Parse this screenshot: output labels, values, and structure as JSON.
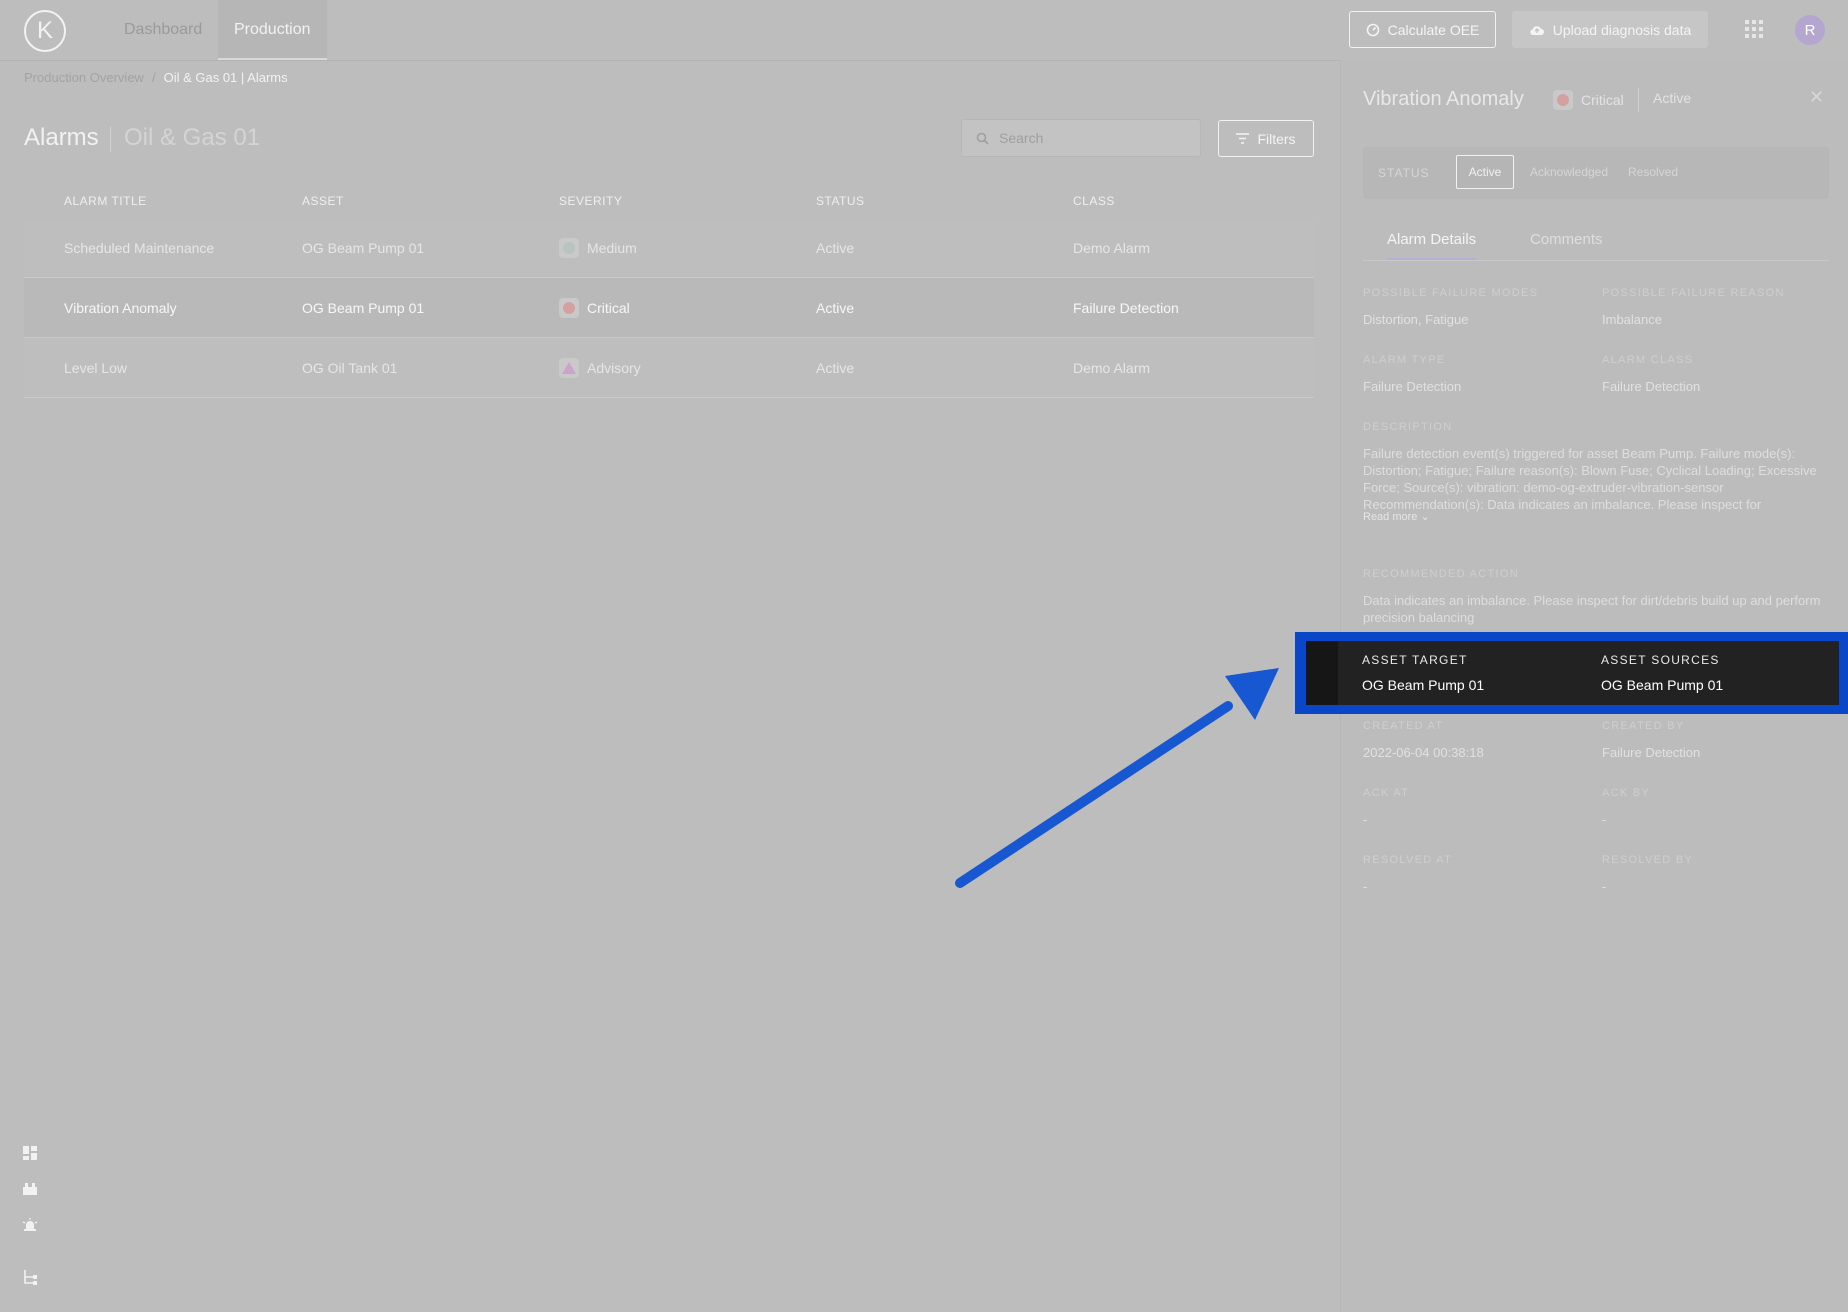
{
  "topbar": {
    "logo_text": "K",
    "tabs": [
      {
        "label": "Dashboard"
      },
      {
        "label": "Production"
      }
    ],
    "calc_oee_label": "Calculate OEE",
    "upload_label": "Upload diagnosis data",
    "avatar_initial": "R"
  },
  "breadcrumb": {
    "root": "Production Overview",
    "separator": "/",
    "current": "Oil & Gas 01 | Alarms"
  },
  "page": {
    "title": "Alarms",
    "subtitle": "Oil & Gas 01",
    "search_placeholder": "Search",
    "filters_label": "Filters"
  },
  "table": {
    "headers": [
      "ALARM TITLE",
      "ASSET",
      "SEVERITY",
      "STATUS",
      "CLASS"
    ],
    "rows": [
      {
        "title": "Scheduled Maintenance",
        "asset": "OG Beam Pump 01",
        "severity": "Medium",
        "status": "Active",
        "class": "Demo Alarm"
      },
      {
        "title": "Vibration Anomaly",
        "asset": "OG Beam Pump 01",
        "severity": "Critical",
        "status": "Active",
        "class": "Failure Detection"
      },
      {
        "title": "Level Low",
        "asset": "OG Oil Tank 01",
        "severity": "Advisory",
        "status": "Active",
        "class": "Demo Alarm"
      }
    ]
  },
  "panel": {
    "title": "Vibration Anomaly",
    "severity": "Critical",
    "status": "Active",
    "status_label": "STATUS",
    "status_options": [
      "Active",
      "Acknowledged",
      "Resolved"
    ],
    "tabs": [
      "Alarm Details",
      "Comments"
    ],
    "fields": {
      "failure_modes_label": "POSSIBLE FAILURE MODES",
      "failure_modes": "Distortion, Fatigue",
      "failure_reason_label": "POSSIBLE FAILURE REASON",
      "failure_reason": "Imbalance",
      "alarm_type_label": "ALARM TYPE",
      "alarm_type": "Failure Detection",
      "alarm_class_label": "ALARM CLASS",
      "alarm_class": "Failure Detection",
      "description_label": "DESCRIPTION",
      "description": "Failure detection event(s) triggered for asset Beam Pump. Failure mode(s): Distortion; Fatigue; Failure reason(s): Blown Fuse; Cyclical Loading; Excessive Force; Source(s): vibration: demo-og-extruder-vibration-sensor Recommendation(s): Data indicates an imbalance. Please inspect for",
      "read_more": "Read more",
      "recommended_label": "RECOMMENDED ACTION",
      "recommended": "Data indicates an imbalance. Please inspect for dirt/debris build up and perform precision balancing",
      "asset_target_label": "ASSET TARGET",
      "asset_target": "OG Beam Pump 01",
      "asset_sources_label": "ASSET SOURCES",
      "asset_sources": "OG Beam Pump 01",
      "created_at_label": "CREATED AT",
      "created_at": "2022-06-04 00:38:18",
      "created_by_label": "CREATED BY",
      "created_by": "Failure Detection",
      "ack_at_label": "ACK AT",
      "ack_at": "-",
      "ack_by_label": "ACK BY",
      "ack_by": "-",
      "resolved_at_label": "RESOLVED AT",
      "resolved_at": "-",
      "resolved_by_label": "RESOLVED BY",
      "resolved_by": "-"
    }
  },
  "icons": {
    "sidebar": [
      "dashboard-icon",
      "factory-icon",
      "alarm-icon",
      "hierarchy-icon"
    ],
    "search": "search-icon",
    "filters": "filter-icon",
    "calc": "gauge-icon",
    "upload": "cloud-upload-icon",
    "apps": "apps-grid-icon",
    "close": "close-icon",
    "chevron": "chevron-down-icon"
  },
  "colors": {
    "highlight": "#0a46c8",
    "arrow": "#1757d1",
    "critical": "#d4a0a0",
    "advisory": "#cca3cc",
    "medium": "#b7c4bf"
  }
}
